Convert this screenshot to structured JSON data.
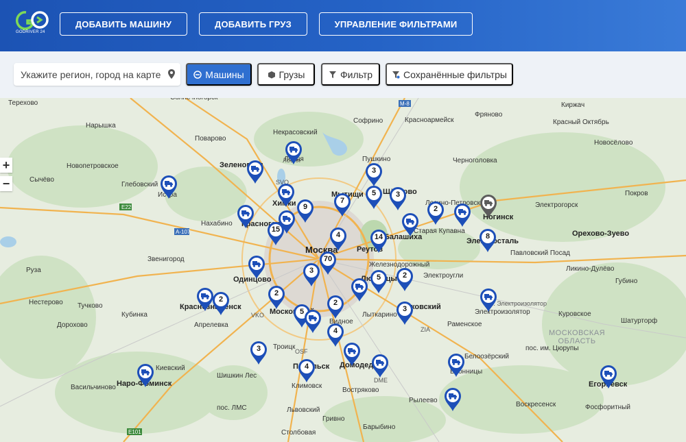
{
  "header": {
    "logo_text": "GODRIVER 24",
    "buttons": [
      {
        "id": "add-car",
        "label": "ДОБАВИТЬ МАШИНУ"
      },
      {
        "id": "add-cargo",
        "label": "ДОБАВИТЬ ГРУЗ"
      },
      {
        "id": "manage-filters",
        "label": "УПРАВЛЕНИЕ ФИЛЬТРАМИ"
      }
    ]
  },
  "toolbar": {
    "search_placeholder": "Укажите регион, город на карте",
    "cars_label": "Машины",
    "cargo_label": "Грузы",
    "filter_label": "Фильтр",
    "saved_filters_label": "Сохранённые фильтры"
  },
  "colors": {
    "header": "#1c53b4",
    "accent": "#2f6fd0",
    "marker": "#1d4fb8",
    "marker_gray": "#5c5c5c"
  },
  "map": {
    "zoom_in": "+",
    "zoom_out": "−",
    "region_label": "МОСКОВСКАЯ\nОБЛАСТЬ",
    "places": [
      "Терехово",
      "Солнечногорск",
      "Лобня",
      "Софрино",
      "Красноармейск",
      "Фряново",
      "Киржач",
      "Нарышка",
      "Красный Октябрь",
      "Некрасовский",
      "Пушкино",
      "Поварово",
      "Новосёлово",
      "Зеленоград",
      "Лобня",
      "Черноголовка",
      "Новопетровское",
      "Сычёво",
      "Глебовский",
      "Истра",
      "Мытищи",
      "Щёлково",
      "Лосино-Петровский",
      "Ногинск",
      "Электрогорск",
      "Покров",
      "Химки",
      "Нахабино",
      "Красногорск",
      "Старая Купавна",
      "Орехово-Зуево",
      "Реутов",
      "Балашиха",
      "Электросталь",
      "Звенигород",
      "Москва",
      "Железнодорожный",
      "Павловский Посад",
      "Руза",
      "Одинцово",
      "Люберцы",
      "Электроугли",
      "Ликино-Дулёво",
      "Губино",
      "Нестерово",
      "Тучково",
      "Краснознаменск",
      "Московский",
      "Жуковский",
      "Электроизолятор",
      "Куровское",
      "Кубинка",
      "Апрелевка",
      "Видное",
      "Лыткарино",
      "Раменское",
      "Шатурторф",
      "Дорохово",
      "Троицк",
      "Домодедово",
      "Белоозёрский",
      "пос. им. Цюрупы",
      "Бронницы",
      "Киевский",
      "Подольск",
      "Наро-Фоминск",
      "Шишкин Лес",
      "Климовск",
      "Востряково",
      "Егорьевск",
      "Васильчиново",
      "пос. ЛМС",
      "Львовский",
      "Рылеево",
      "Воскресенск",
      "Фосфоритный",
      "Столбовая",
      "Барыбино",
      "Гривно",
      "пос. Электроизолятор",
      "VKO",
      "SVO",
      "ZIA",
      "DME",
      "OSF"
    ],
    "road_labels": [
      "M-8",
      "E22",
      "A-107",
      "E101",
      "A-105"
    ],
    "markers": [
      {
        "label": "",
        "kind": "truck"
      },
      {
        "label": "",
        "kind": "truck"
      },
      {
        "label": "3",
        "kind": "count"
      },
      {
        "label": "",
        "kind": "truck"
      },
      {
        "label": "",
        "kind": "truck"
      },
      {
        "label": "5",
        "kind": "count"
      },
      {
        "label": "3",
        "kind": "count"
      },
      {
        "label": "7",
        "kind": "count"
      },
      {
        "label": "9",
        "kind": "count"
      },
      {
        "label": "",
        "kind": "truck"
      },
      {
        "label": "",
        "kind": "truck"
      },
      {
        "label": "2",
        "kind": "count"
      },
      {
        "label": "",
        "kind": "truck"
      },
      {
        "label": "",
        "kind": "truck-gray"
      },
      {
        "label": "15",
        "kind": "count"
      },
      {
        "label": "4",
        "kind": "count"
      },
      {
        "label": "",
        "kind": "truck"
      },
      {
        "label": "14",
        "kind": "count"
      },
      {
        "label": "8",
        "kind": "count"
      },
      {
        "label": "70",
        "kind": "count"
      },
      {
        "label": "",
        "kind": "truck"
      },
      {
        "label": "3",
        "kind": "count"
      },
      {
        "label": "5",
        "kind": "count"
      },
      {
        "label": "2",
        "kind": "count"
      },
      {
        "label": "",
        "kind": "truck"
      },
      {
        "label": "",
        "kind": "truck"
      },
      {
        "label": "2",
        "kind": "count"
      },
      {
        "label": "2",
        "kind": "count"
      },
      {
        "label": "",
        "kind": "truck"
      },
      {
        "label": "2",
        "kind": "count"
      },
      {
        "label": "5",
        "kind": "count"
      },
      {
        "label": "",
        "kind": "truck"
      },
      {
        "label": "3",
        "kind": "count"
      },
      {
        "label": "4",
        "kind": "count"
      },
      {
        "label": "3",
        "kind": "count"
      },
      {
        "label": "",
        "kind": "truck"
      },
      {
        "label": "",
        "kind": "truck"
      },
      {
        "label": "",
        "kind": "truck"
      },
      {
        "label": "4",
        "kind": "count"
      },
      {
        "label": "",
        "kind": "truck"
      },
      {
        "label": "",
        "kind": "truck"
      },
      {
        "label": "",
        "kind": "truck"
      }
    ]
  }
}
